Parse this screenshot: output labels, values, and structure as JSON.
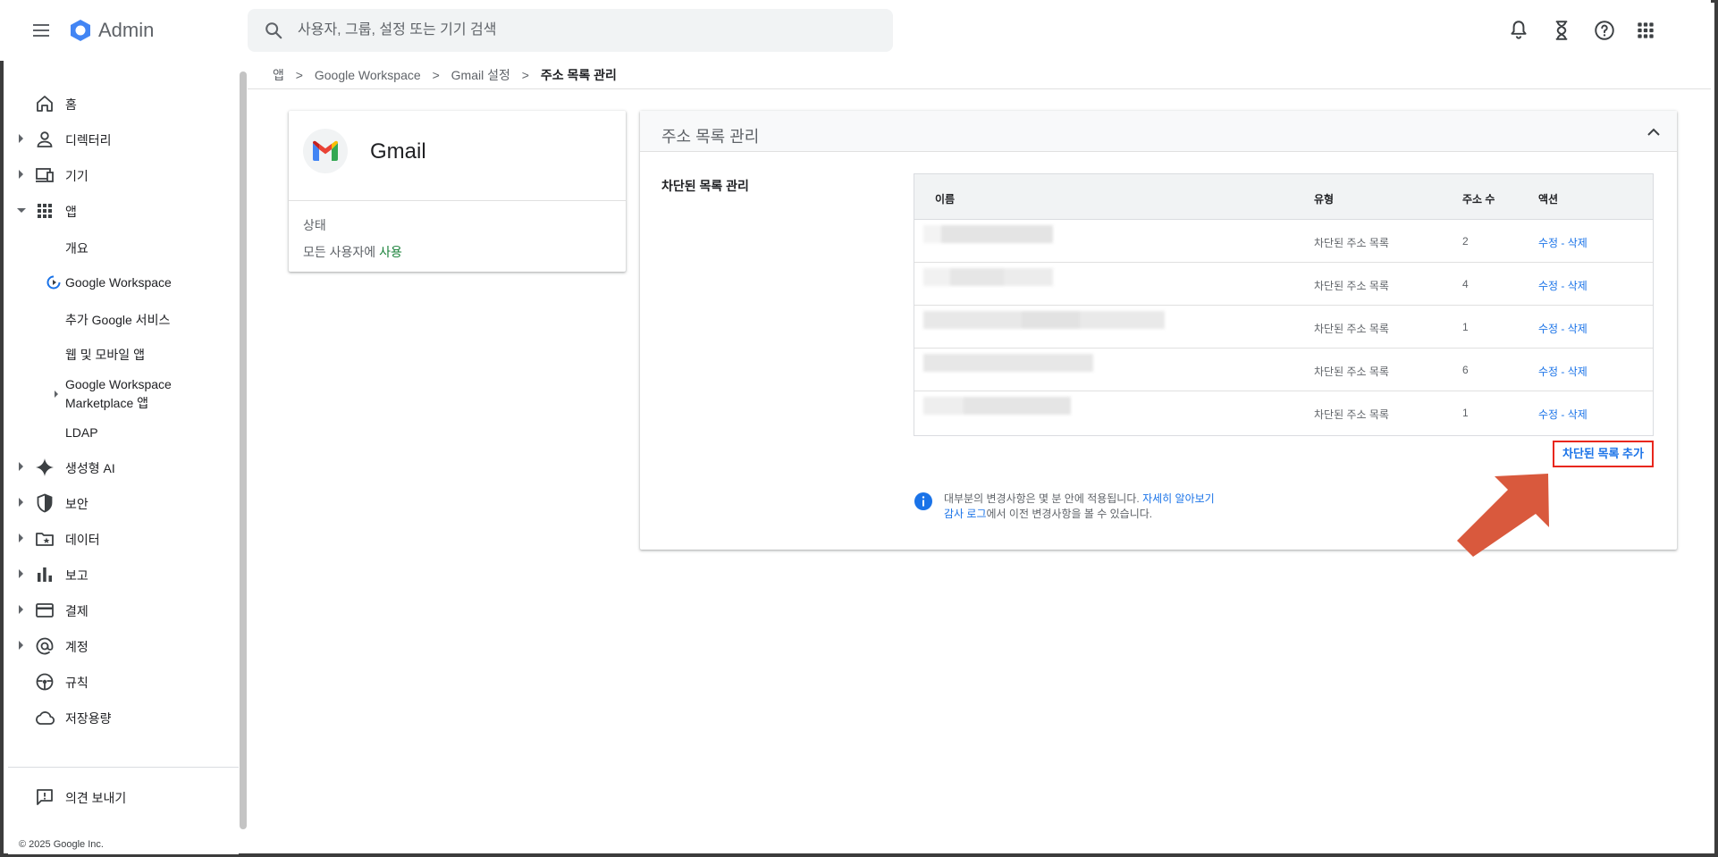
{
  "header": {
    "app_name": "Admin",
    "search_placeholder": "사용자, 그룹, 설정 또는 기기 검색",
    "icons": [
      "menu-icon",
      "admin-logo",
      "search-icon",
      "notifications-icon",
      "tasks-icon",
      "help-icon",
      "apps-icon"
    ]
  },
  "sidebar": {
    "items": [
      {
        "label": "홈",
        "icon": "home-icon"
      },
      {
        "label": "디렉터리",
        "icon": "person-icon"
      },
      {
        "label": "기기",
        "icon": "devices-icon"
      },
      {
        "label": "앱",
        "icon": "apps-grid-icon"
      },
      {
        "label": "생성형 AI",
        "icon": "sparkle-icon"
      },
      {
        "label": "보안",
        "icon": "shield-icon"
      },
      {
        "label": "데이터",
        "icon": "folder-star-icon"
      },
      {
        "label": "보고",
        "icon": "bar-chart-icon"
      },
      {
        "label": "결제",
        "icon": "credit-card-icon"
      },
      {
        "label": "계정",
        "icon": "at-icon"
      },
      {
        "label": "규칙",
        "icon": "rules-icon"
      },
      {
        "label": "저장용량",
        "icon": "cloud-icon"
      }
    ],
    "app_subitems": {
      "overview": "개요",
      "workspace": "Google Workspace",
      "more_services": "추가 Google 서비스",
      "web_mobile": "웹 및 모바일 앱",
      "marketplace_line1": "Google Workspace",
      "marketplace_line2": "Marketplace 앱",
      "ldap": "LDAP"
    },
    "feedback": "의견 보내기",
    "copyright": "© 2025 Google Inc."
  },
  "breadcrumb": {
    "items": [
      "앱",
      "Google Workspace",
      "Gmail 설정"
    ],
    "current": "주소 목록 관리",
    "separator": ">"
  },
  "gmail_card": {
    "title": "Gmail",
    "status_label": "상태",
    "status_prefix": "모든 사용자에",
    "status_value": "사용"
  },
  "main_card": {
    "title": "주소 목록 관리",
    "section_label": "차단된 목록 관리",
    "table": {
      "headers": {
        "name": "이름",
        "type": "유형",
        "count": "주소 수",
        "actions": "액션"
      },
      "rows": [
        {
          "type": "차단된 주소 목록",
          "count": "2",
          "actions": "수정 - 삭제"
        },
        {
          "type": "차단된 주소 목록",
          "count": "4",
          "actions": "수정 - 삭제"
        },
        {
          "type": "차단된 주소 목록",
          "count": "1",
          "actions": "수정 - 삭제"
        },
        {
          "type": "차단된 주소 목록",
          "count": "6",
          "actions": "수정 - 삭제"
        },
        {
          "type": "차단된 주소 목록",
          "count": "1",
          "actions": "수정 - 삭제"
        }
      ]
    },
    "add_blocked_list": "차단된 목록 추가",
    "info": {
      "line1_text": "대부분의 변경사항은 몇 분 안에 적용됩니다.",
      "line1_link": "자세히 알아보기",
      "line2_link": "감사 로그",
      "line2_text": "에서 이전 변경사항을 볼 수 있습니다."
    }
  },
  "colors": {
    "accent_link": "#1a73e8",
    "status_green": "#188038",
    "highlight_red": "#e8271d",
    "annotation_orange": "#d9593d"
  }
}
